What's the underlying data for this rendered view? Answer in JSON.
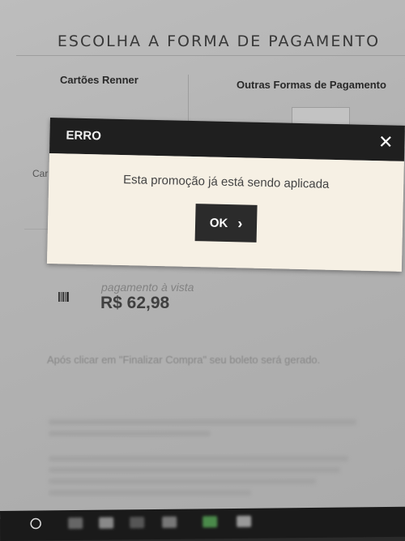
{
  "page": {
    "title": "ESCOLHA A FORMA DE PAGAMENTO"
  },
  "tabs": {
    "cards_label": "Cartões Renner",
    "other_label": "Outras Formas de Pagamento",
    "cut_label": "Car"
  },
  "modal": {
    "title": "ERRO",
    "close_icon": "✕",
    "message": "Esta promoção já está sendo aplicada",
    "ok_label": "OK",
    "ok_icon": "›"
  },
  "payment": {
    "label": "pagamento à vista",
    "value": "R$ 62,98",
    "note": "Após clicar em \"Finalizar Compra\" seu boleto será gerado."
  },
  "taskbar": {
    "start_icon": "windows-start-icon"
  }
}
